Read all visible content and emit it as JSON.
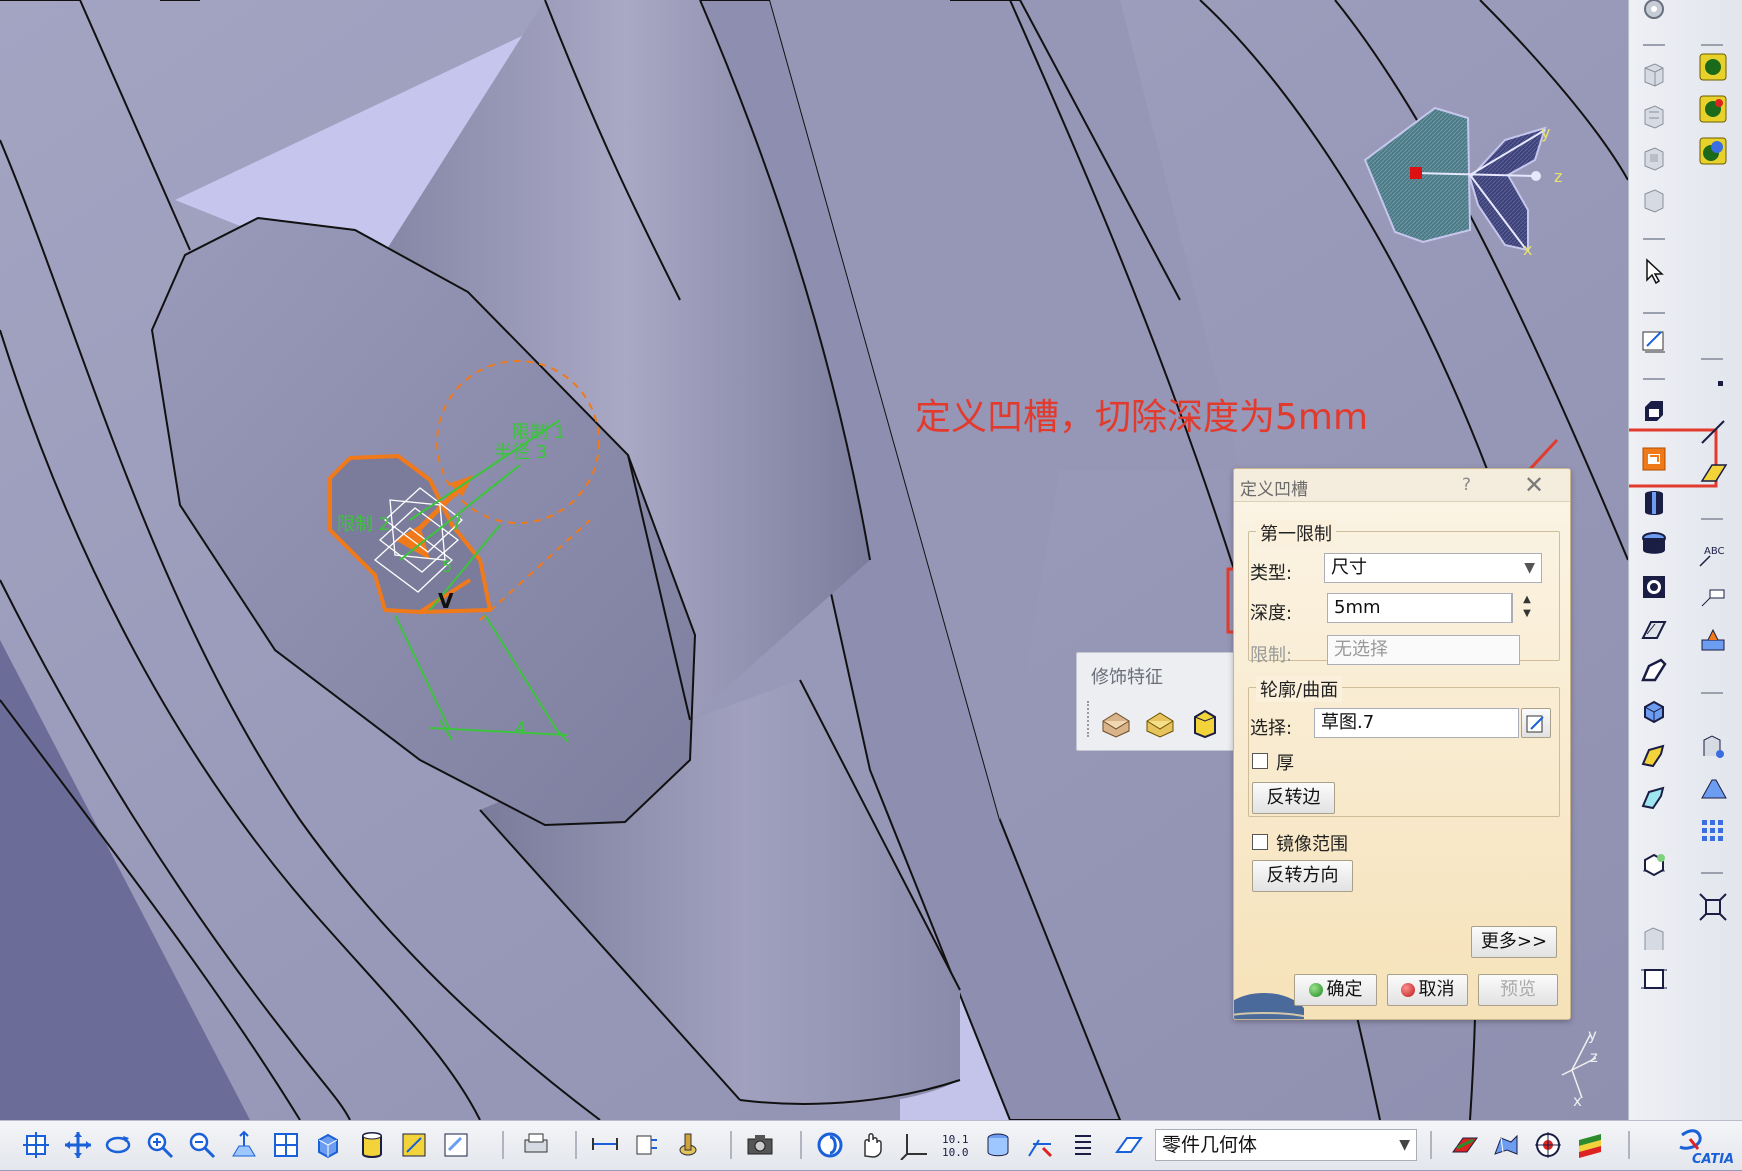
{
  "annotation": "定义凹槽，切除深度为5mm",
  "viewport": {
    "sketch_labels": {
      "limit_top": "限制 1",
      "radius": "半径 3",
      "limit_left": "限制 2",
      "v_mark": "V",
      "dim_5": "5",
      "dim_4": "4"
    },
    "compass_axes": {
      "y": "y",
      "z": "z",
      "x": "x"
    },
    "triad_axes": {
      "y": "y",
      "z": "z",
      "x": "x"
    }
  },
  "cosmetic_toolbar": {
    "title": "修饰特征"
  },
  "dialog": {
    "title": "定义凹槽",
    "help": "?",
    "first_limit": {
      "group_label": "第一限制",
      "type_label": "类型:",
      "type_value": "尺寸",
      "depth_label": "深度:",
      "depth_value": "5mm",
      "limit_label": "限制:",
      "limit_value": "无选择"
    },
    "profile": {
      "group_label": "轮廓/曲面",
      "select_label": "选择:",
      "select_value": "草图.7",
      "thick_label": "厚",
      "reverse_side": "反转边"
    },
    "mirrored_extent": "镜像范围",
    "reverse_direction": "反转方向",
    "more": "更多>>",
    "ok": "确定",
    "cancel": "取消",
    "preview": "预览"
  },
  "bottom_bar": {
    "geometry_set": "零件几何体"
  },
  "right_bar": {
    "abc_text": "ABC"
  },
  "brand": {
    "logo": "CATIA"
  },
  "colors": {
    "annotation": "#e23b2e",
    "highlight_box": "#e23b2e",
    "sketch": "#f07a1a",
    "constraint": "#3cc43c"
  }
}
